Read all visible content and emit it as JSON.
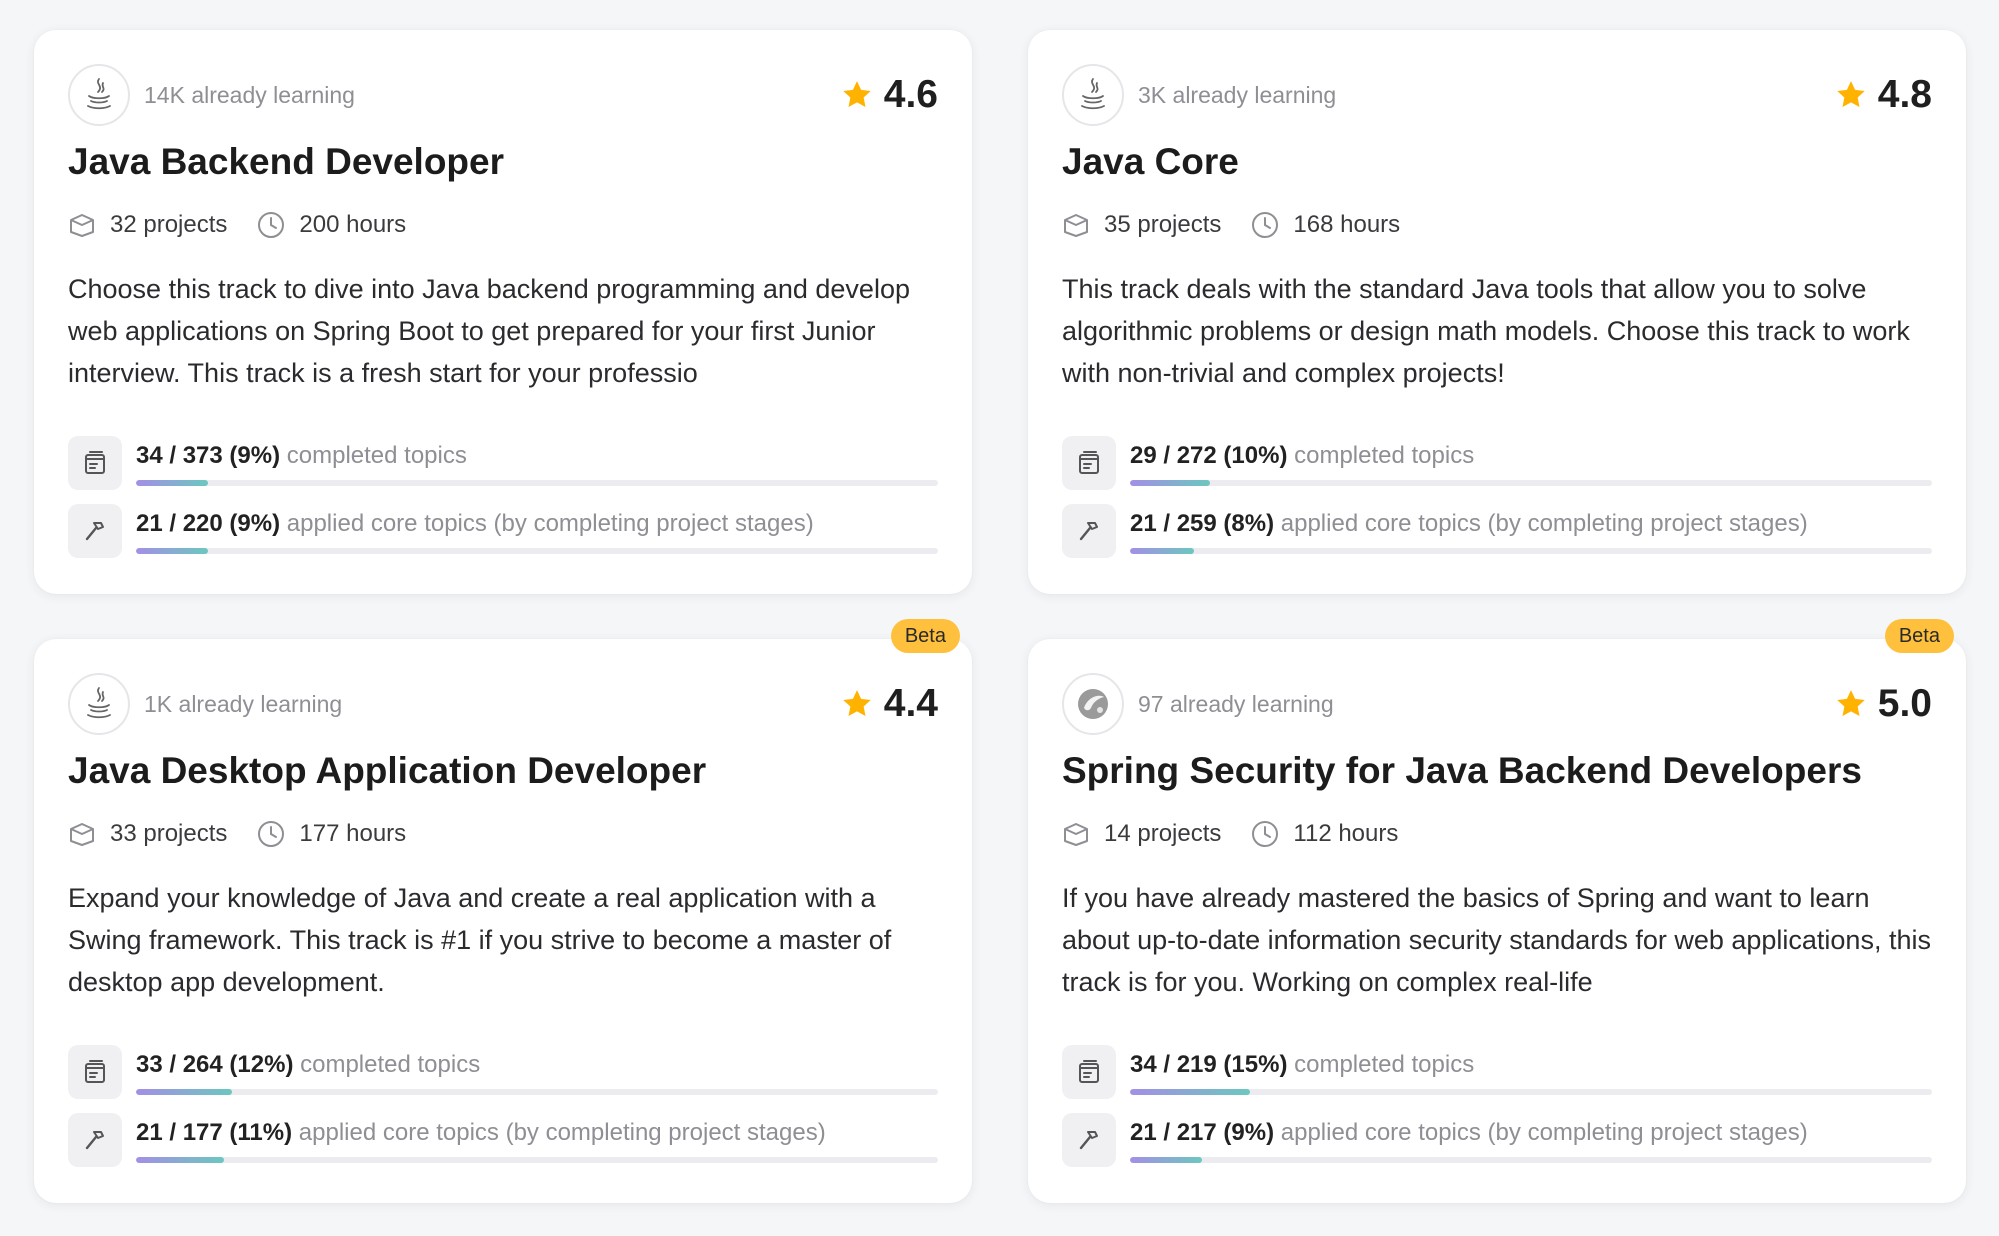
{
  "colors": {
    "accent_star": "#ffb300",
    "beta_badge": "#ffc13d",
    "progress_start": "#a38fe6",
    "progress_end": "#6cc7bf"
  },
  "cards": [
    {
      "icon": "java-icon",
      "learners": "14K already learning",
      "rating": "4.6",
      "title": "Java Backend Developer",
      "projects": "32 projects",
      "hours": "200 hours",
      "description": "Choose this track to dive into Java backend programming and develop web applications on Spring Boot to get prepared for your first Junior interview. This track is a fresh start for your professio",
      "beta": null,
      "topics": {
        "count": "34 / 373 (9%)",
        "label": "completed topics",
        "fraction": 0.09
      },
      "applied": {
        "count": "21 / 220 (9%)",
        "label": "applied core topics (by completing project stages)",
        "fraction": 0.09
      }
    },
    {
      "icon": "java-icon",
      "learners": "3K already learning",
      "rating": "4.8",
      "title": "Java Core",
      "projects": "35 projects",
      "hours": "168 hours",
      "description": "This track deals with the standard Java tools that allow you to solve algorithmic problems or design math models. Choose this track to work with non-trivial and complex projects!",
      "beta": null,
      "topics": {
        "count": "29 / 272 (10%)",
        "label": "completed topics",
        "fraction": 0.1
      },
      "applied": {
        "count": "21 / 259 (8%)",
        "label": "applied core topics (by completing project stages)",
        "fraction": 0.08
      }
    },
    {
      "icon": "java-icon",
      "learners": "1K already learning",
      "rating": "4.4",
      "title": "Java Desktop Application Developer",
      "projects": "33 projects",
      "hours": "177 hours",
      "description": "Expand your knowledge of Java and create a real application with a Swing framework. This track is #1 if you strive to become a master of desktop app development.",
      "beta": "Beta",
      "topics": {
        "count": "33 / 264 (12%)",
        "label": "completed topics",
        "fraction": 0.12
      },
      "applied": {
        "count": "21 / 177 (11%)",
        "label": "applied core topics (by completing project stages)",
        "fraction": 0.11
      }
    },
    {
      "icon": "spring-security-icon",
      "learners": "97 already learning",
      "rating": "5.0",
      "title": "Spring Security for Java Backend Developers",
      "projects": "14 projects",
      "hours": "112 hours",
      "description": "If you have already mastered the basics of Spring and want to learn about up-to-date information security standards for web applications, this track is for you. Working on complex real-life",
      "beta": "Beta",
      "topics": {
        "count": "34 / 219 (15%)",
        "label": "completed topics",
        "fraction": 0.15
      },
      "applied": {
        "count": "21 / 217 (9%)",
        "label": "applied core topics (by completing project stages)",
        "fraction": 0.09
      }
    }
  ]
}
